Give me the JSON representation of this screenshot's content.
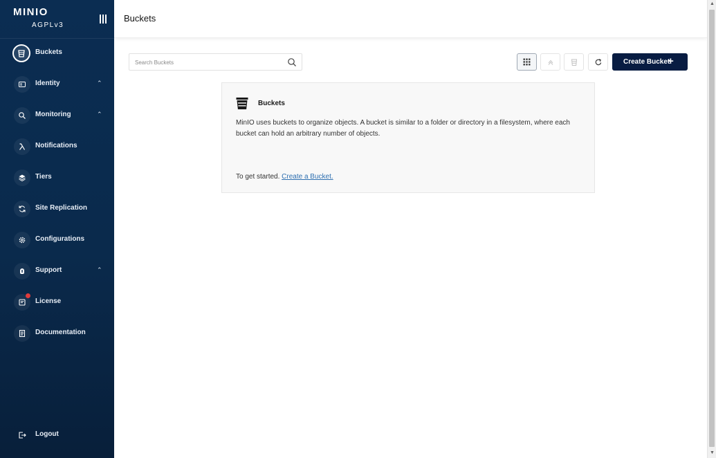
{
  "brand": {
    "name": "MINIO",
    "license": "AGPLv3"
  },
  "sidebar": {
    "items": [
      {
        "label": "Buckets",
        "icon": "bucket-icon",
        "active": true
      },
      {
        "label": "Identity",
        "icon": "identity-icon",
        "expandable": true
      },
      {
        "label": "Monitoring",
        "icon": "monitoring-icon",
        "expandable": true
      },
      {
        "label": "Notifications",
        "icon": "lambda-icon"
      },
      {
        "label": "Tiers",
        "icon": "tiers-icon"
      },
      {
        "label": "Site Replication",
        "icon": "replication-icon"
      },
      {
        "label": "Configurations",
        "icon": "gear-icon"
      },
      {
        "label": "Support",
        "icon": "support-icon",
        "expandable": true
      },
      {
        "label": "License",
        "icon": "license-icon",
        "has_alert": true
      },
      {
        "label": "Documentation",
        "icon": "documentation-icon"
      }
    ],
    "logout_label": "Logout"
  },
  "header": {
    "title": "Buckets"
  },
  "toolbar": {
    "search_placeholder": "Search Buckets",
    "search_value": "",
    "create_label": "Create Bucket",
    "create_icon": "plus-icon"
  },
  "card": {
    "title": "Buckets",
    "description": "MinIO uses buckets to organize objects. A bucket is similar to a folder or directory in a filesystem, where each bucket can hold an arbitrary number of objects.",
    "start_prefix": "To get started. ",
    "start_link": "Create a Bucket."
  },
  "colors": {
    "sidebar_bg": "#0a2a4c",
    "primary_button": "#081c42",
    "link": "#2e6fb0",
    "alert_dot": "#e03b3b"
  }
}
